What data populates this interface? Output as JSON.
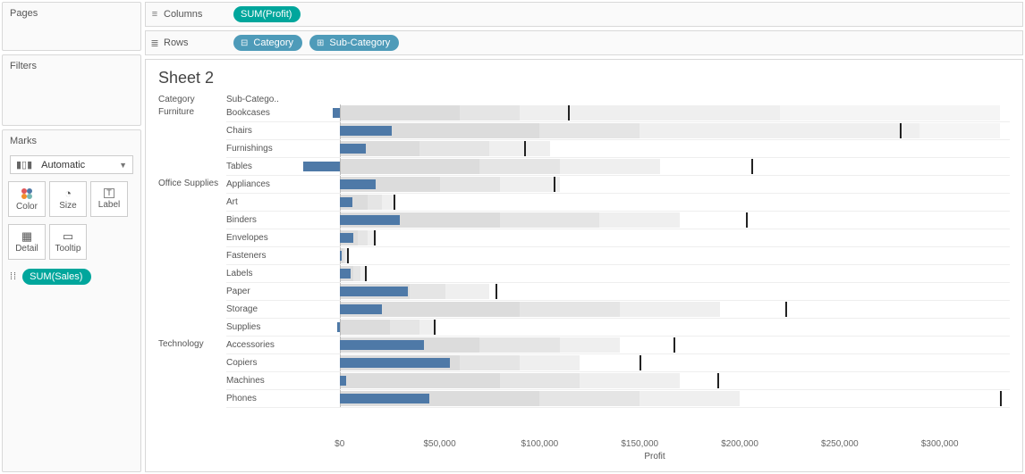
{
  "left": {
    "pages_label": "Pages",
    "filters_label": "Filters",
    "marks_label": "Marks",
    "marks_type": "Automatic",
    "buttons": {
      "color": "Color",
      "size": "Size",
      "label": "Label",
      "detail": "Detail",
      "tooltip": "Tooltip"
    },
    "detail_pill": "SUM(Sales)"
  },
  "shelves": {
    "columns_label": "Columns",
    "rows_label": "Rows",
    "columns_pill": "SUM(Profit)",
    "rows_pill_1": "Category",
    "rows_pill_2": "Sub-Category"
  },
  "viz": {
    "title": "Sheet 2",
    "header_category": "Category",
    "header_subcategory": "Sub-Catego..",
    "axis_label": "Profit",
    "ticks": [
      "$0",
      "$50,000",
      "$100,000",
      "$150,000",
      "$200,000",
      "$250,000",
      "$300,000"
    ]
  },
  "chart_data": {
    "type": "bar",
    "xlabel": "Profit",
    "xlim": [
      -20000,
      335000
    ],
    "categories": [
      {
        "name": "Furniture",
        "rows": [
          {
            "sub": "Bookcases",
            "profit": -3500,
            "gray": [
              60000,
              30000,
              130000
            ],
            "ref": 114000,
            "far": 330000
          },
          {
            "sub": "Chairs",
            "profit": 26000,
            "gray": [
              100000,
              50000,
              140000
            ],
            "ref": 280000,
            "far": 330000
          },
          {
            "sub": "Furnishings",
            "profit": 13000,
            "gray": [
              40000,
              35000,
              30000
            ],
            "ref": 92000,
            "far": 0
          },
          {
            "sub": "Tables",
            "profit": -18000,
            "gray": [
              70000,
              40000,
              50000
            ],
            "ref": 206000,
            "far": 0
          }
        ]
      },
      {
        "name": "Office Supplies",
        "rows": [
          {
            "sub": "Appliances",
            "profit": 18000,
            "gray": [
              50000,
              30000,
              30000
            ],
            "ref": 107000,
            "far": 0
          },
          {
            "sub": "Art",
            "profit": 6500,
            "gray": [
              14000,
              7000,
              6000
            ],
            "ref": 27000,
            "far": 0
          },
          {
            "sub": "Binders",
            "profit": 30000,
            "gray": [
              80000,
              50000,
              40000
            ],
            "ref": 203000,
            "far": 0
          },
          {
            "sub": "Envelopes",
            "profit": 7000,
            "gray": [
              9000,
              5000,
              4000
            ],
            "ref": 17000,
            "far": 0
          },
          {
            "sub": "Fasteners",
            "profit": 1000,
            "gray": [
              2000,
              1000,
              800
            ],
            "ref": 3500,
            "far": 0
          },
          {
            "sub": "Labels",
            "profit": 5500,
            "gray": [
              7000,
              3500,
              2500
            ],
            "ref": 12500,
            "far": 0
          },
          {
            "sub": "Paper",
            "profit": 34000,
            "gray": [
              35000,
              18000,
              22000
            ],
            "ref": 78000,
            "far": 0
          },
          {
            "sub": "Storage",
            "profit": 21000,
            "gray": [
              90000,
              50000,
              50000
            ],
            "ref": 223000,
            "far": 0
          },
          {
            "sub": "Supplies",
            "profit": -1200,
            "gray": [
              25000,
              15000,
              8000
            ],
            "ref": 47000,
            "far": 0
          }
        ]
      },
      {
        "name": "Technology",
        "rows": [
          {
            "sub": "Accessories",
            "profit": 42000,
            "gray": [
              70000,
              40000,
              30000
            ],
            "ref": 167000,
            "far": 0
          },
          {
            "sub": "Copiers",
            "profit": 55000,
            "gray": [
              60000,
              30000,
              30000
            ],
            "ref": 150000,
            "far": 0
          },
          {
            "sub": "Machines",
            "profit": 3400,
            "gray": [
              80000,
              40000,
              50000
            ],
            "ref": 189000,
            "far": 0
          },
          {
            "sub": "Phones",
            "profit": 45000,
            "gray": [
              100000,
              50000,
              50000
            ],
            "ref": 330000,
            "far": 0
          }
        ]
      }
    ]
  }
}
